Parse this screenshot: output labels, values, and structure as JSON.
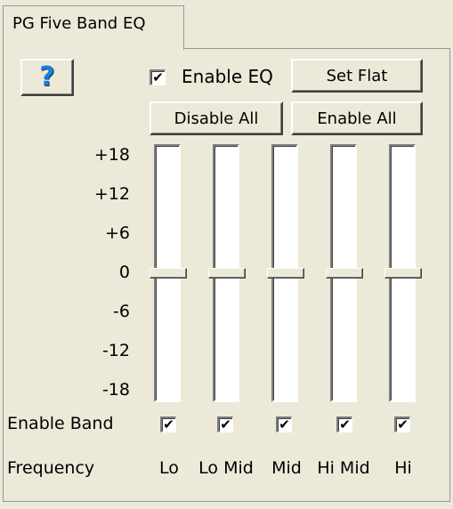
{
  "tab": {
    "title": "PG Five Band EQ"
  },
  "controls": {
    "help_label": "?",
    "enable_eq_label": "Enable EQ",
    "enable_eq_checked": true,
    "set_flat_label": "Set Flat",
    "disable_all_label": "Disable All",
    "enable_all_label": "Enable All"
  },
  "scale": [
    "+18",
    "+12",
    "+6",
    "0",
    "-6",
    "-12",
    "-18"
  ],
  "scale_range": [
    -18,
    18
  ],
  "rows": {
    "enable_band_label": "Enable Band",
    "frequency_label": "Frequency"
  },
  "bands": [
    {
      "name": "Lo",
      "gain": 0,
      "enabled": true
    },
    {
      "name": "Lo Mid",
      "gain": 0,
      "enabled": true
    },
    {
      "name": "Mid",
      "gain": 0,
      "enabled": true
    },
    {
      "name": "Hi Mid",
      "gain": 0,
      "enabled": true
    },
    {
      "name": "Hi",
      "gain": 0,
      "enabled": true
    }
  ],
  "colors": {
    "background": "#ece9d8",
    "help_icon": "#1a7fd6"
  },
  "icons": {
    "help": "question-mark-icon",
    "check": "checkmark-icon"
  }
}
